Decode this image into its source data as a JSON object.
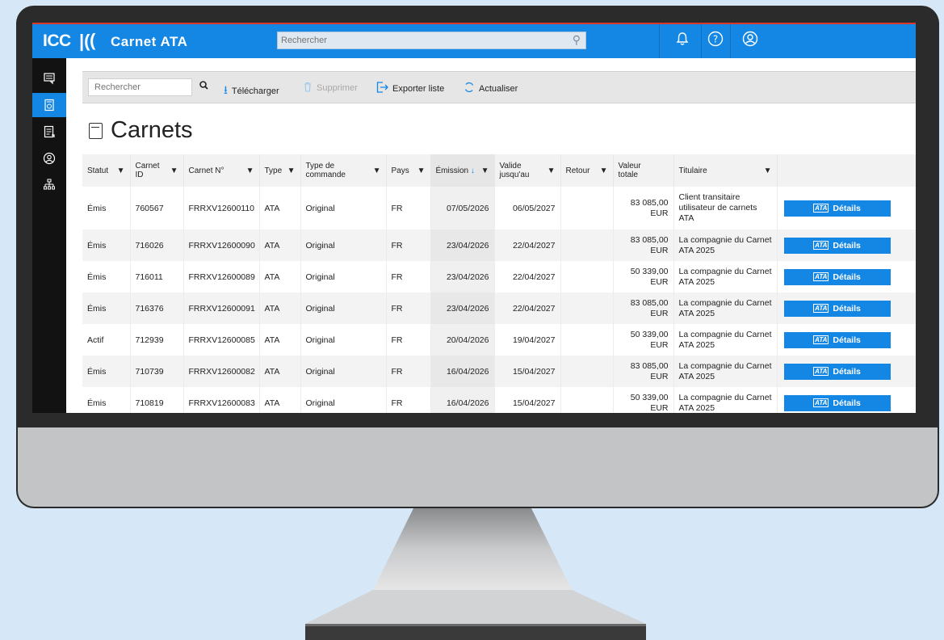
{
  "header": {
    "logo": "ICC",
    "app_title": "Carnet ATA",
    "search_placeholder": "Rechercher"
  },
  "toolbar": {
    "search_placeholder": "Rechercher",
    "download": "Télécharger",
    "delete": "Supprimer",
    "export": "Exporter liste",
    "refresh": "Actualiser"
  },
  "page": {
    "title": "Carnets"
  },
  "table": {
    "columns": {
      "statut": "Statut",
      "carnet_id_1": "Carnet",
      "carnet_id_2": "ID",
      "carnet_no": "Carnet N°",
      "type": "Type",
      "type_cmd_1": "Type de",
      "type_cmd_2": "commande",
      "pays": "Pays",
      "emission": "Émission",
      "valide_1": "Valide",
      "valide_2": "jusqu'au",
      "retour": "Retour",
      "valeur_1": "Valeur",
      "valeur_2": "totale",
      "titulaire": "Titulaire"
    },
    "details_label": "Détails",
    "rows": [
      {
        "statut": "Émis",
        "id": "760567",
        "no": "FRRXV12600110",
        "type": "ATA",
        "cmd": "Original",
        "pays": "FR",
        "emission": "07/05/2026",
        "valide": "06/05/2027",
        "retour": "",
        "valeur_1": "83 085,00",
        "valeur_2": "EUR",
        "titulaire": "Client transitaire utilisateur de carnets ATA"
      },
      {
        "statut": "Émis",
        "id": "716026",
        "no": "FRRXV12600090",
        "type": "ATA",
        "cmd": "Original",
        "pays": "FR",
        "emission": "23/04/2026",
        "valide": "22/04/2027",
        "retour": "",
        "valeur_1": "83 085,00",
        "valeur_2": "EUR",
        "titulaire": "La compagnie du Carnet ATA 2025"
      },
      {
        "statut": "Émis",
        "id": "716011",
        "no": "FRRXV12600089",
        "type": "ATA",
        "cmd": "Original",
        "pays": "FR",
        "emission": "23/04/2026",
        "valide": "22/04/2027",
        "retour": "",
        "valeur_1": "50 339,00",
        "valeur_2": "EUR",
        "titulaire": "La compagnie du Carnet ATA 2025"
      },
      {
        "statut": "Émis",
        "id": "716376",
        "no": "FRRXV12600091",
        "type": "ATA",
        "cmd": "Original",
        "pays": "FR",
        "emission": "23/04/2026",
        "valide": "22/04/2027",
        "retour": "",
        "valeur_1": "83 085,00",
        "valeur_2": "EUR",
        "titulaire": "La compagnie du Carnet ATA 2025"
      },
      {
        "statut": "Actif",
        "id": "712939",
        "no": "FRRXV12600085",
        "type": "ATA",
        "cmd": "Original",
        "pays": "FR",
        "emission": "20/04/2026",
        "valide": "19/04/2027",
        "retour": "",
        "valeur_1": "50 339,00",
        "valeur_2": "EUR",
        "titulaire": "La compagnie du Carnet ATA 2025"
      },
      {
        "statut": "Émis",
        "id": "710739",
        "no": "FRRXV12600082",
        "type": "ATA",
        "cmd": "Original",
        "pays": "FR",
        "emission": "16/04/2026",
        "valide": "15/04/2027",
        "retour": "",
        "valeur_1": "83 085,00",
        "valeur_2": "EUR",
        "titulaire": "La compagnie du Carnet ATA 2025"
      },
      {
        "statut": "Émis",
        "id": "710819",
        "no": "FRRXV12600083",
        "type": "ATA",
        "cmd": "Original",
        "pays": "FR",
        "emission": "16/04/2026",
        "valide": "15/04/2027",
        "retour": "",
        "valeur_1": "50 339,00",
        "valeur_2": "EUR",
        "titulaire": "La compagnie du Carnet ATA 2025"
      }
    ]
  },
  "colors": {
    "accent": "#1487e5",
    "header_top": "#d9372b",
    "sidebar": "#121212",
    "background": "#d6e8f8"
  }
}
